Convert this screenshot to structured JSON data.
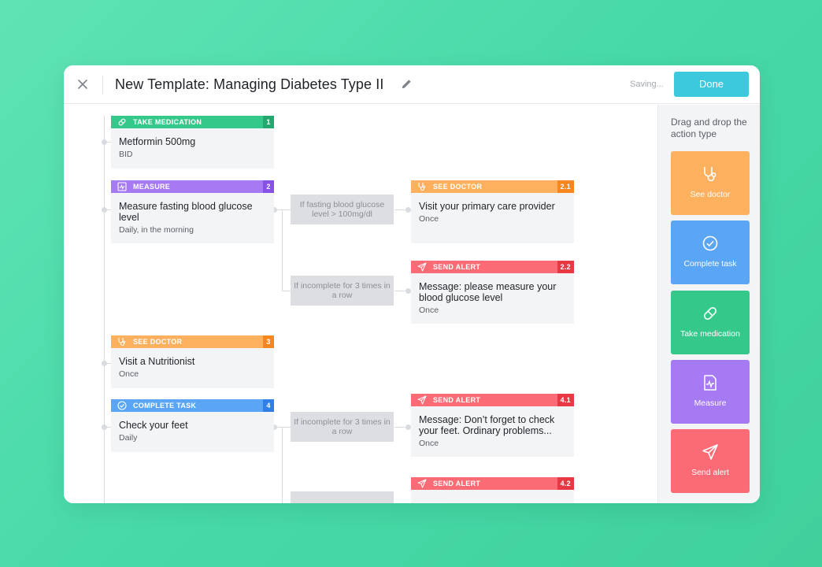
{
  "header": {
    "title": "New Template: Managing Diabetes Type II",
    "saving_text": "Saving...",
    "done_label": "Done"
  },
  "colors": {
    "medication": "#34c98b",
    "medication_dark": "#23a96f",
    "measure": "#a57af3",
    "measure_dark": "#8651e8",
    "doctor": "#fdb05e",
    "doctor_dark": "#f7861e",
    "task": "#5aa6f5",
    "task_dark": "#2f7fe6",
    "alert": "#fb6b75",
    "alert_dark": "#e83843",
    "done_button": "#3cc8dd"
  },
  "steps": [
    {
      "type_label": "TAKE MEDICATION",
      "icon": "pill-icon",
      "number": "1",
      "title": "Metformin 500mg",
      "subtitle": "BID"
    },
    {
      "type_label": "MEASURE",
      "icon": "chart-icon",
      "number": "2",
      "title": "Measure fasting blood glucose level",
      "subtitle": "Daily, in the morning"
    },
    {
      "type_label": "SEE DOCTOR",
      "icon": "stethoscope-icon",
      "number": "2.1",
      "title": "Visit your primary care provider",
      "subtitle": "Once"
    },
    {
      "type_label": "SEND ALERT",
      "icon": "send-icon",
      "number": "2.2",
      "title": "Message: please measure your blood glucose level",
      "subtitle": "Once"
    },
    {
      "type_label": "SEE DOCTOR",
      "icon": "stethoscope-icon",
      "number": "3",
      "title": "Visit a Nutritionist",
      "subtitle": "Once"
    },
    {
      "type_label": "COMPLETE TASK",
      "icon": "check-icon",
      "number": "4",
      "title": "Check your feet",
      "subtitle": "Daily"
    },
    {
      "type_label": "SEND ALERT",
      "icon": "send-icon",
      "number": "4.1",
      "title": "Message: Don’t forget to check your feet. Ordinary problems...",
      "subtitle": "Once"
    },
    {
      "type_label": "SEND ALERT",
      "icon": "send-icon",
      "number": "4.2",
      "title": "",
      "subtitle": ""
    }
  ],
  "conditions": [
    "If fasting blood glucose level > 100mg/dl",
    "If incomplete for 3 times in a row",
    "If incomplete for 3 times in a row",
    ""
  ],
  "sidebar": {
    "hint": "Drag and drop the action type",
    "tiles": [
      {
        "label": "See doctor",
        "icon": "stethoscope-icon"
      },
      {
        "label": "Complete task",
        "icon": "check-circle-icon"
      },
      {
        "label": "Take medication",
        "icon": "pill-icon"
      },
      {
        "label": "Measure",
        "icon": "chart-icon"
      },
      {
        "label": "Send alert",
        "icon": "send-icon"
      }
    ]
  }
}
